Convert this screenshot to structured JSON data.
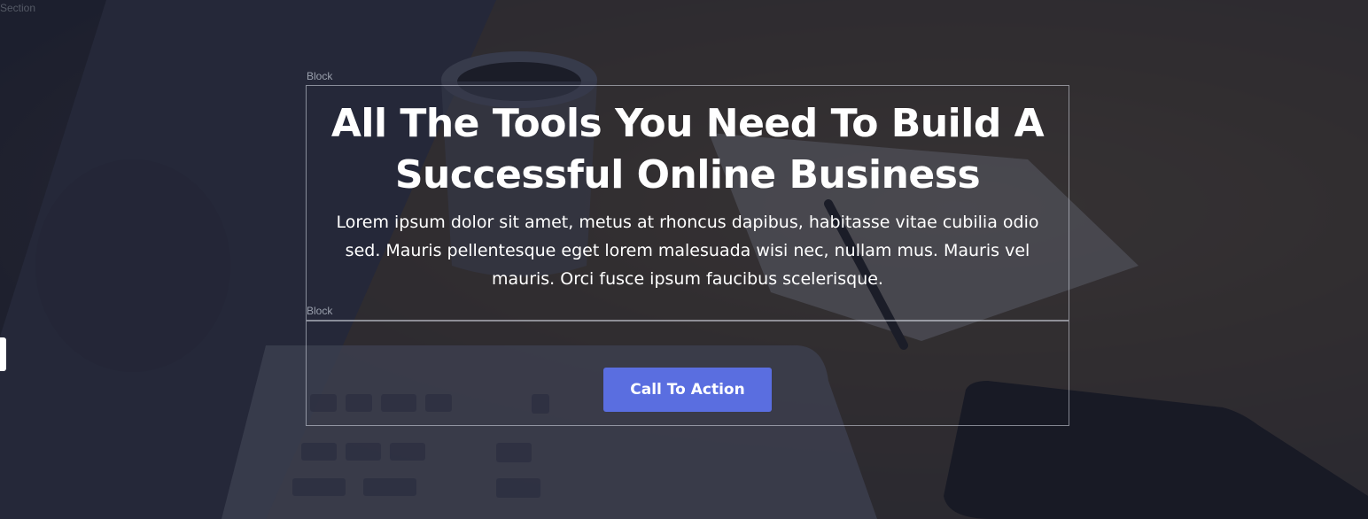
{
  "section": {
    "label": "Section"
  },
  "blocks": [
    {
      "label": "Block"
    },
    {
      "label": "Block"
    }
  ],
  "hero": {
    "headline": "All The Tools You Need To Build A Successful Online Business",
    "body": "Lorem ipsum dolor sit amet, metus at rhoncus dapibus, habitasse vitae cubilia odio sed. Mauris pellentesque eget lorem malesuada wisi nec, nullam mus. Mauris vel mauris. Orci fusce ipsum faucibus scelerisque.",
    "cta_label": "Call To Action"
  },
  "colors": {
    "button": "#5a6ee0",
    "overlay": "#1c2030",
    "text": "#ffffff"
  }
}
